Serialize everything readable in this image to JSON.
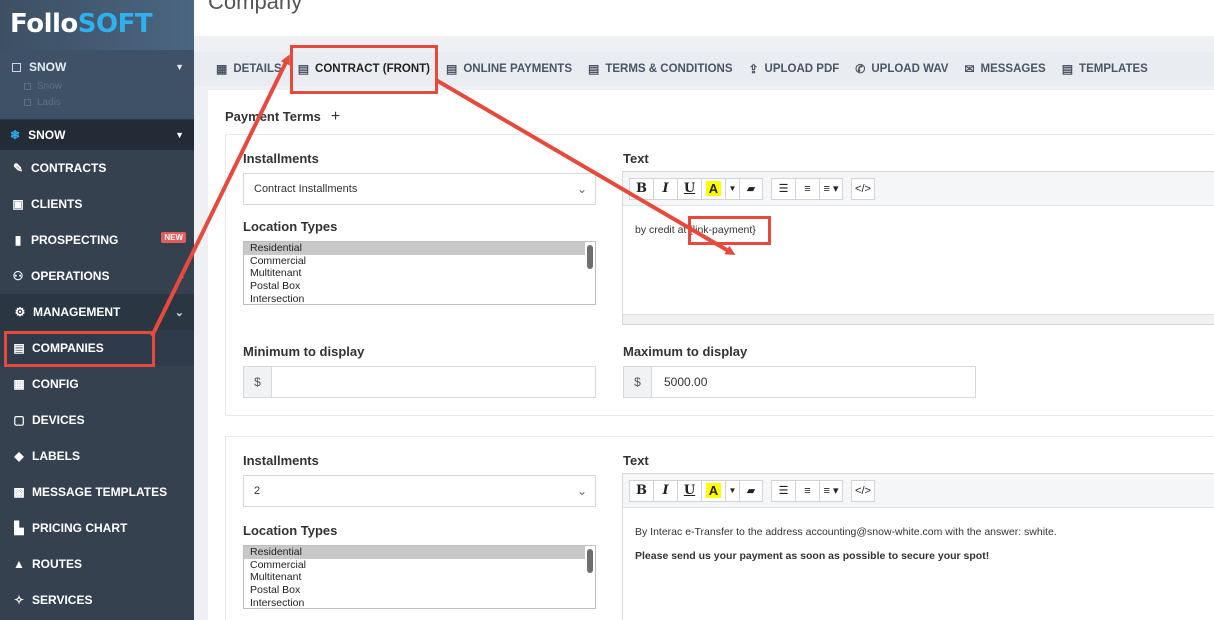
{
  "brand": {
    "part1": "Follo",
    "part2": "SOFT"
  },
  "sidebar": {
    "company": {
      "label": "SNOW",
      "subs": [
        "Snow",
        "Ladis"
      ]
    },
    "snow": {
      "label": "SNOW"
    },
    "items": [
      {
        "label": "CONTRACTS",
        "icon": "contract-icon"
      },
      {
        "label": "CLIENTS",
        "icon": "clients-icon"
      },
      {
        "label": "PROSPECTING",
        "icon": "prospecting-icon",
        "badge": "NEW"
      },
      {
        "label": "OPERATIONS",
        "icon": "operations-icon"
      },
      {
        "label": "MANAGEMENT",
        "icon": "management-icon"
      },
      {
        "label": "COMPANIES",
        "icon": "companies-icon"
      },
      {
        "label": "CONFIG",
        "icon": "config-icon"
      },
      {
        "label": "DEVICES",
        "icon": "devices-icon"
      },
      {
        "label": "LABELS",
        "icon": "labels-icon"
      },
      {
        "label": "MESSAGE TEMPLATES",
        "icon": "message-templates-icon"
      },
      {
        "label": "PRICING CHART",
        "icon": "pricing-chart-icon"
      },
      {
        "label": "ROUTES",
        "icon": "routes-icon"
      },
      {
        "label": "SERVICES",
        "icon": "services-icon"
      }
    ]
  },
  "page": {
    "title": "Company"
  },
  "tabs": [
    {
      "label": "DETAILS",
      "icon": "details-icon"
    },
    {
      "label": "CONTRACT (FRONT)",
      "icon": "document-icon"
    },
    {
      "label": "ONLINE PAYMENTS",
      "icon": "document-icon"
    },
    {
      "label": "TERMS & CONDITIONS",
      "icon": "document-icon"
    },
    {
      "label": "UPLOAD PDF",
      "icon": "upload-icon"
    },
    {
      "label": "UPLOAD WAV",
      "icon": "phone-icon"
    },
    {
      "label": "MESSAGES",
      "icon": "messages-icon"
    },
    {
      "label": "TEMPLATES",
      "icon": "document-icon"
    }
  ],
  "payment_terms": {
    "title": "Payment Terms",
    "add": "+"
  },
  "labels": {
    "installments": "Installments",
    "text": "Text",
    "location_types": "Location Types",
    "minimum": "Minimum to display",
    "maximum": "Maximum to display",
    "currency": "$"
  },
  "location_types": [
    "Residential",
    "Commercial",
    "Multitenant",
    "Postal Box",
    "Intersection"
  ],
  "term1": {
    "installments_value": "Contract Installments",
    "text": "by credit at {link-payment}",
    "minimum": "",
    "maximum": "5000.00"
  },
  "term2": {
    "installments_value": "2",
    "text_line1": "By Interac e-Transfer to the address accounting@snow-white.com with the answer: swhite.",
    "text_line2": "Please send us your payment as soon as possible to secure your spot!"
  },
  "toolbar": {
    "bold": "B",
    "italic": "I",
    "underline": "U",
    "color": "A",
    "code": "</>"
  },
  "colors": {
    "annotation": "#e64a3c",
    "sidebar": "#364150",
    "brand_accent": "#2fb1f0"
  }
}
